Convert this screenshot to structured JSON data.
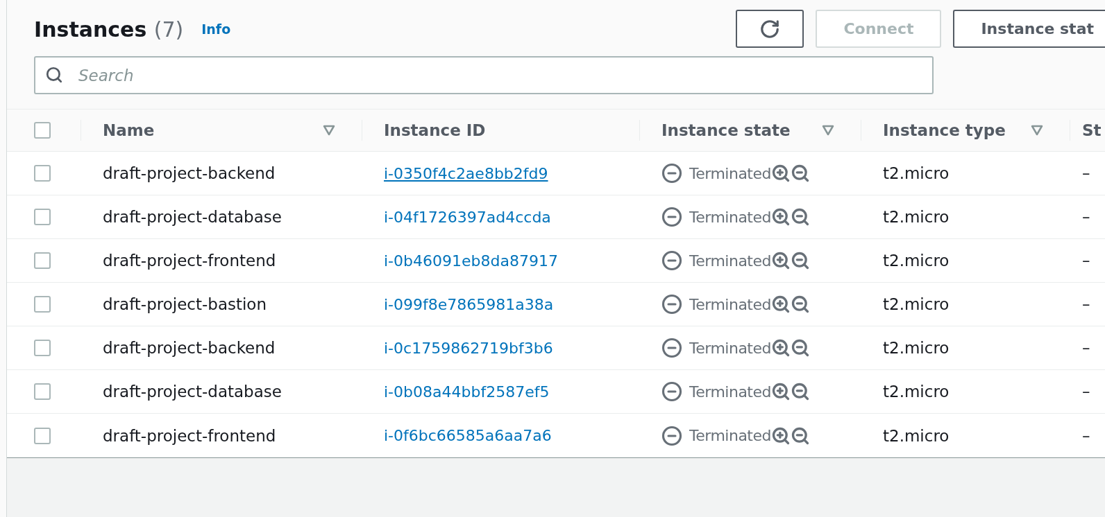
{
  "header": {
    "title": "Instances",
    "count": "(7)",
    "info_link": "Info"
  },
  "actions": [
    {
      "kind": "refresh",
      "disabled": false
    },
    {
      "kind": "text",
      "label": "Connect",
      "disabled": true
    },
    {
      "kind": "text",
      "label": "Instance stat",
      "disabled": false
    }
  ],
  "search": {
    "placeholder": "Search"
  },
  "table": {
    "select_all": {
      "checked": false
    },
    "columns": [
      {
        "label": "Name",
        "filter": true
      },
      {
        "label": "Instance ID",
        "filter": false
      },
      {
        "label": "Instance state",
        "filter": true
      },
      {
        "label": "Instance type",
        "filter": true
      },
      {
        "label": "St",
        "filter": false
      }
    ],
    "rows": [
      {
        "checked": false,
        "name": "draft-project-backend",
        "id": "i-0350f4c2ae8bb2fd9",
        "underlined": true,
        "state": "Terminated",
        "type": "t2.micro",
        "column_5": "–"
      },
      {
        "checked": false,
        "name": "draft-project-database",
        "id": "i-04f1726397ad4ccda",
        "underlined": false,
        "state": "Terminated",
        "type": "t2.micro",
        "column_5": "–"
      },
      {
        "checked": false,
        "name": "draft-project-frontend",
        "id": "i-0b46091eb8da87917",
        "underlined": false,
        "state": "Terminated",
        "type": "t2.micro",
        "column_5": "–"
      },
      {
        "checked": false,
        "name": "draft-project-bastion",
        "id": "i-099f8e7865981a38a",
        "underlined": false,
        "state": "Terminated",
        "type": "t2.micro",
        "column_5": "–"
      },
      {
        "checked": false,
        "name": "draft-project-backend",
        "id": "i-0c1759862719bf3b6",
        "underlined": false,
        "state": "Terminated",
        "type": "t2.micro",
        "column_5": "–"
      },
      {
        "checked": false,
        "name": "draft-project-database",
        "id": "i-0b08a44bbf2587ef5",
        "underlined": false,
        "state": "Terminated",
        "type": "t2.micro",
        "column_5": "–"
      },
      {
        "checked": false,
        "name": "draft-project-frontend",
        "id": "i-0f6bc66585a6aa7a6",
        "underlined": false,
        "state": "Terminated",
        "type": "t2.micro",
        "column_5": "–"
      }
    ]
  }
}
